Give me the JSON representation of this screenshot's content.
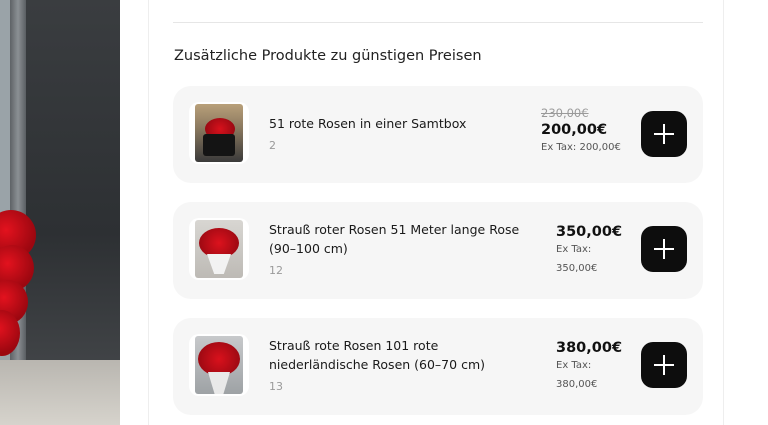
{
  "section": {
    "title": "Zusätzliche Produkte zu günstigen Preisen"
  },
  "products": [
    {
      "name": "51 rote Rosen in einer Samtbox",
      "qty": "2",
      "old_price": "230,00€",
      "price": "200,00€",
      "ex_tax": "Ex Tax: 200,00€",
      "add_icon": "plus-icon"
    },
    {
      "name": "Strauß roter Rosen 51 Meter lange Rose (90–100 cm)",
      "qty": "12",
      "price": "350,00€",
      "ex_tax_label": "Ex Tax:",
      "ex_tax_value": "350,00€",
      "add_icon": "plus-icon"
    },
    {
      "name": "Strauß rote Rosen 101 rote niederländische Rosen (60–70 cm)",
      "qty": "13",
      "price": "380,00€",
      "ex_tax_label": "Ex Tax:",
      "ex_tax_value": "380,00€",
      "add_icon": "plus-icon"
    }
  ],
  "colors": {
    "card_bg": "#f6f6f6",
    "button_bg": "#0d0d0d",
    "old_price": "#9a9a9a"
  }
}
